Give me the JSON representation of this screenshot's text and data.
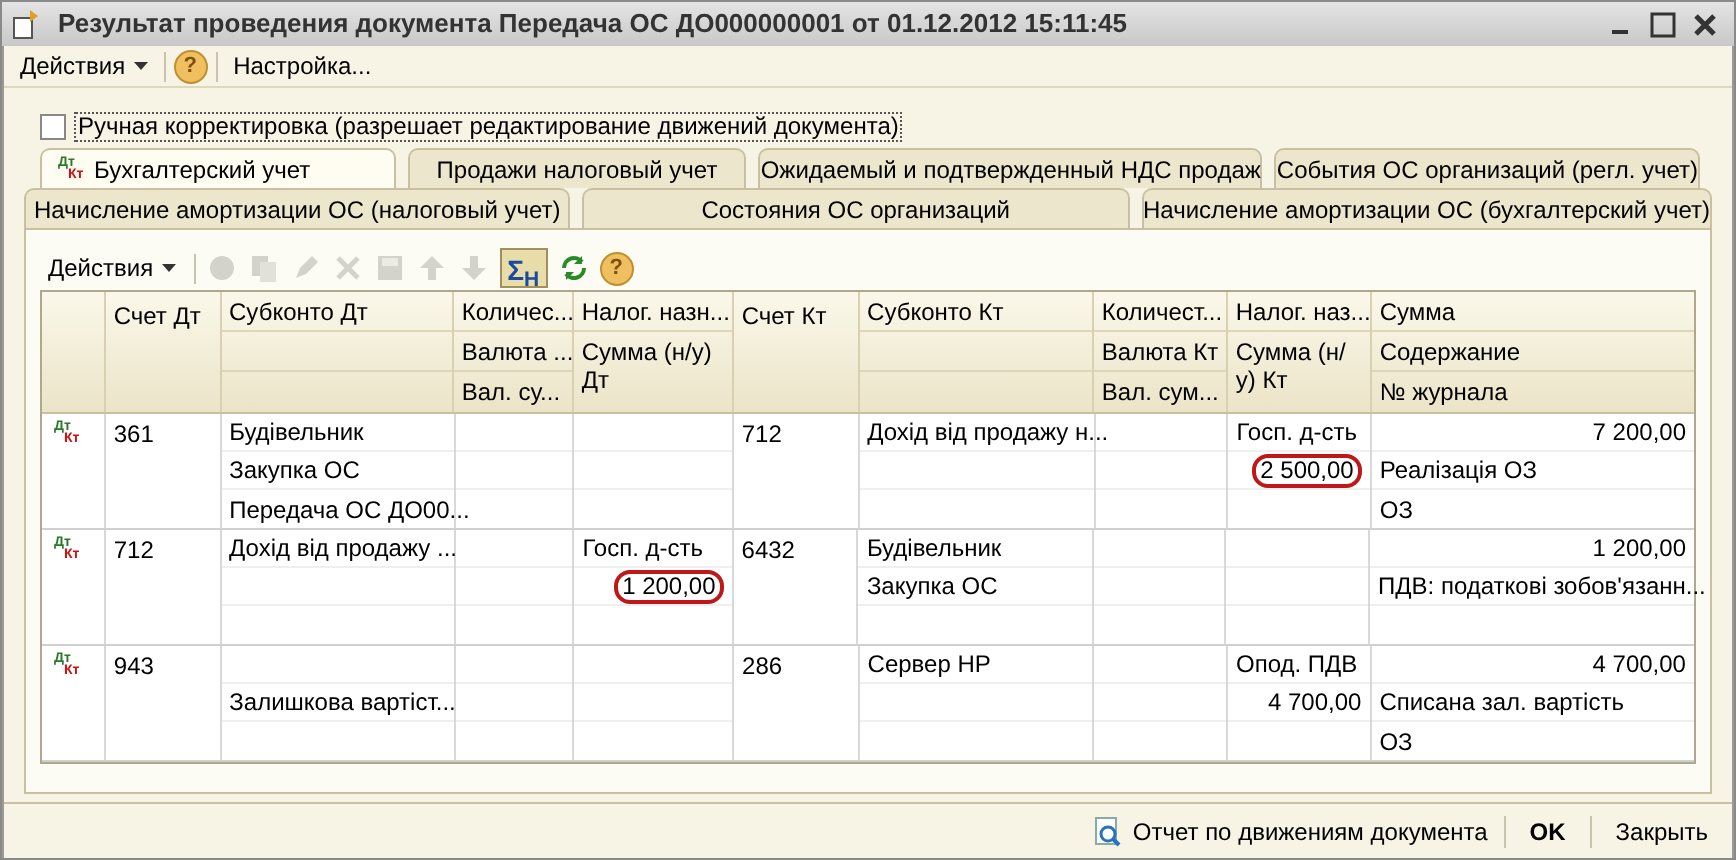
{
  "window": {
    "title": "Результат проведения документа Передача ОС ДО000000001 от 01.12.2012 15:11:45"
  },
  "menu": {
    "actions": "Действия",
    "help": "?",
    "settings": "Настройка..."
  },
  "manual_edit": {
    "label": "Ручная корректировка (разрешает редактирование движений документа)",
    "checked": false
  },
  "tab_rows": [
    [
      {
        "label": "Бухгалтерский учет",
        "selected": true,
        "marker": {
          "dt": "Дт",
          "kt": "Кт"
        }
      },
      {
        "label": "Продажи налоговый учет",
        "selected": false
      },
      {
        "label": "Ожидаемый и подтвержденный НДС продаж",
        "selected": false
      },
      {
        "label": "События ОС организаций (регл. учет)",
        "selected": false
      }
    ],
    [
      {
        "label": "Начисление амортизации ОС (налоговый учет)",
        "selected": false
      },
      {
        "label": "Состояния ОС организаций",
        "selected": false
      },
      {
        "label": "Начисление амортизации ОС (бухгалтерский учет)",
        "selected": false
      }
    ]
  ],
  "toolbar": {
    "actions": "Действия",
    "buttons": [
      {
        "kind": "add",
        "disabled": true
      },
      {
        "kind": "copy",
        "disabled": true
      },
      {
        "kind": "edit",
        "disabled": true
      },
      {
        "kind": "delete",
        "disabled": true
      },
      {
        "kind": "save",
        "disabled": true
      },
      {
        "kind": "up",
        "disabled": true
      },
      {
        "kind": "down",
        "disabled": true
      },
      {
        "kind": "sum",
        "on": true,
        "label": "Σ$_{H}$"
      },
      {
        "kind": "refresh"
      },
      {
        "kind": "help",
        "label": "?"
      }
    ]
  },
  "table": {
    "columns": [
      {
        "kind": "single",
        "lines": [
          "Счет Дт"
        ]
      },
      {
        "kind": "subconto",
        "lines": [
          "Субконто Дт"
        ]
      },
      {
        "kind": "triple",
        "lines": [
          "Количес...",
          "Валюта ...",
          "Вал. су..."
        ]
      },
      {
        "kind": "double",
        "lines": [
          "Налог. назн...",
          "Сумма (н/у) Дт"
        ]
      },
      {
        "kind": "single",
        "lines": [
          "Счет Кт"
        ]
      },
      {
        "kind": "subconto",
        "lines": [
          "Субконто Кт"
        ]
      },
      {
        "kind": "triple",
        "lines": [
          "Количест...",
          "Валюта Кт",
          "Вал. сум..."
        ]
      },
      {
        "kind": "double",
        "lines": [
          "Налог. наз...",
          "Сумма (н/у) Кт"
        ]
      },
      {
        "kind": "triple",
        "lines": [
          "Сумма",
          "Содержание",
          "№ журнала"
        ]
      }
    ],
    "rows": [
      {
        "marker": {
          "dt": "Дт",
          "kt": "Кт"
        },
        "dt_account": "361",
        "subconto_dt_1": "Будівельник",
        "subconto_dt_2": "Закупка ОС",
        "subconto_dt_3": "Передача ОС ДО00...",
        "kt_account": "712",
        "subconto_kt_1": "Дохід від продажу н...",
        "tax_purpose_kt": "Госп. д-сть",
        "tax_sum_kt": "2 500,00",
        "tax_sum_circled": true,
        "amount": "7 200,00",
        "content": "Реалізація ОЗ",
        "journal": "ОЗ"
      },
      {
        "marker": {
          "dt": "Дт",
          "kt": "Кт"
        },
        "dt_account": "712",
        "subconto_dt_1": "Дохід від продажу ...",
        "tax_purpose_dt": "Госп. д-сть",
        "tax_sum_dt": "1 200,00",
        "tax_sum_circled": true,
        "kt_account": "6432",
        "subconto_kt_1": "Будівельник",
        "subconto_kt_2": "Закупка ОС",
        "amount": "1 200,00",
        "content": "ПДВ: податкові зобов'язанн..."
      },
      {
        "marker": {
          "dt": "Дт",
          "kt": "Кт"
        },
        "dt_account": "943",
        "subconto_dt_2": "Залишкова вартіст...",
        "kt_account": "286",
        "subconto_kt_1": "Сервер НР",
        "tax_purpose_kt": "Опод. ПДВ",
        "tax_sum_kt": "4 700,00",
        "tax_sum_circled": false,
        "amount": "4 700,00",
        "content": "Списана зал. вартість",
        "journal": "ОЗ"
      }
    ]
  },
  "footer": {
    "report": "Отчет по движениям документа",
    "ok": "OK",
    "close": "Закрыть"
  }
}
